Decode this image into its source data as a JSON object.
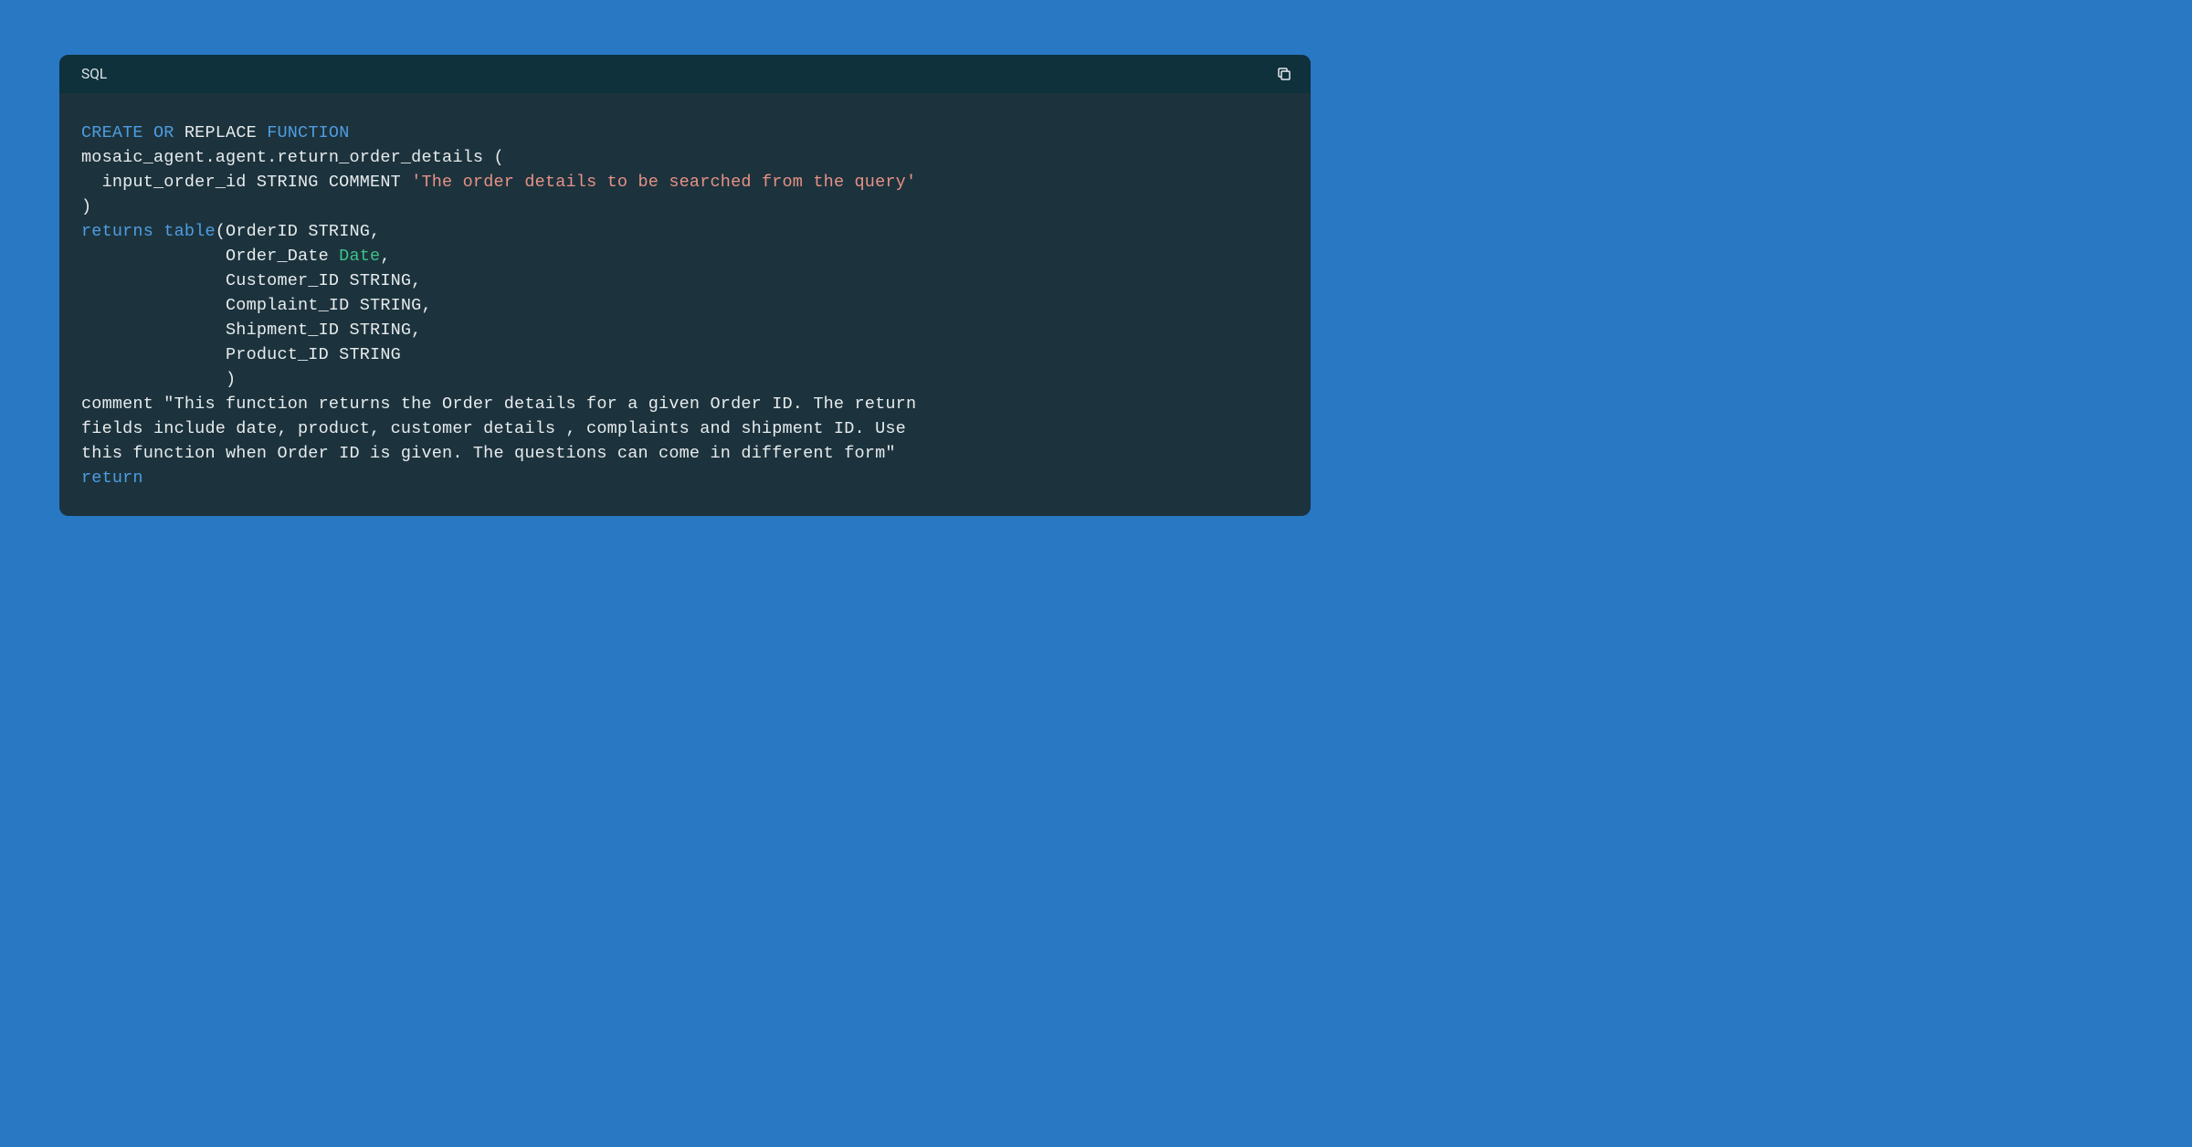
{
  "titlebar": {
    "label": "SQL"
  },
  "code": {
    "line1_create_or": "CREATE OR",
    "line1_replace": " REPLACE ",
    "line1_function": "FUNCTION",
    "line2": "mosaic_agent.agent.return_order_details (",
    "line3_lead": "  input_order_id STRING COMMENT ",
    "line3_str": "'The order details to be searched from the query'",
    "line4": ")",
    "line5_returns": "returns",
    "line5_sp": " ",
    "line5_table": "table",
    "line5_rest": "(OrderID STRING,",
    "line6": "              Order_Date ",
    "line6_type": "Date",
    "line6_tail": ",",
    "line7": "              Customer_ID STRING,",
    "line8": "              Complaint_ID STRING,",
    "line9": "              Shipment_ID STRING,",
    "line10": "              Product_ID STRING",
    "line11": "              )",
    "line12": "comment \"This function returns the Order details for a given Order ID. The return",
    "line13": "fields include date, product, customer details , complaints and shipment ID. Use",
    "line14": "this function when Order ID is given. The questions can come in different form\"",
    "line15_return": "return"
  }
}
